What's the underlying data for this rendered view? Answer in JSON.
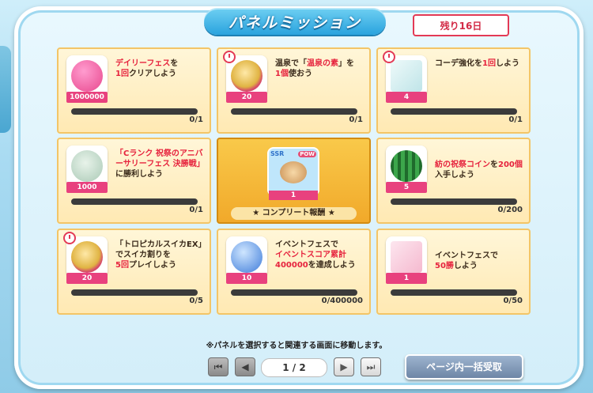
{
  "title": "パネルミッション",
  "days_left": "残り16日",
  "panels": [
    {
      "qty": "1000000",
      "desc_a": "デイリーフェス",
      "desc_b": "を",
      "desc_c": "1回",
      "desc_d": "クリアしよう",
      "progress": "0/1",
      "progress_ratio": 0,
      "timer": false,
      "icon": "coin-icon",
      "color": "#e8478d"
    },
    {
      "qty": "20",
      "desc_a": "温泉で「",
      "desc_b": "温泉の素",
      "desc_c": "」を",
      "desc_d": "1個",
      "desc_e": "使おう",
      "progress": "0/1",
      "progress_ratio": 0,
      "timer": true,
      "icon": "orb-icon",
      "color": "#e0b443"
    },
    {
      "qty": "4",
      "desc_a": "コーデ強化を",
      "desc_b": "1回",
      "desc_c": "しよう",
      "progress": "0/1",
      "progress_ratio": 0,
      "timer": true,
      "icon": "cloth-icon",
      "color": "#bfe4e8"
    },
    {
      "qty": "1000",
      "desc_a": "「Cランク 祝祭のアニバーサリーフェス 決勝戦」",
      "desc_b": "に勝利しよう",
      "progress": "0/1",
      "progress_ratio": 0,
      "timer": false,
      "icon": "medal-icon",
      "color": "#a9c9b5"
    },
    {
      "qty": "5",
      "desc_a": "紡の祝祭コイン",
      "desc_b": "を",
      "desc_c": "200個",
      "desc_d": "入手しよう",
      "progress": "0/200",
      "progress_ratio": 0,
      "timer": false,
      "icon": "watermelon-icon",
      "color": "#3ca64b"
    },
    {
      "qty": "20",
      "desc_a": "「トロピカルスイカEX」",
      "desc_b": "でスイカ割りを",
      "desc_c": "5回",
      "desc_d": "プレイしよう",
      "progress": "0/5",
      "progress_ratio": 0,
      "timer": true,
      "icon": "orb-icon",
      "color": "#e0b443"
    },
    {
      "qty": "10",
      "desc_a": "イベントフェスで",
      "desc_b": "イベントスコア累計400000",
      "desc_c": "を達成しよう",
      "progress": "0/400000",
      "progress_ratio": 0,
      "timer": false,
      "icon": "heart-gem-icon",
      "color": "#3d7bd9"
    },
    {
      "qty": "1",
      "desc_a": "イベントフェスで",
      "desc_b": "50勝",
      "desc_c": "しよう",
      "progress": "0/50",
      "progress_ratio": 0,
      "timer": false,
      "icon": "gift-icon",
      "color": "#f5b9cf"
    }
  ],
  "complete": {
    "ssr": "SSR",
    "pow": "POW",
    "qty": "1",
    "label": "★ コンプリート報酬 ★"
  },
  "note": "※パネルを選択すると関連する画面に移動します。",
  "pager": {
    "indicator": "1 / 2",
    "first": "⏮",
    "prev": "◀",
    "next": "▶",
    "last": "⏭"
  },
  "bulk_button": "ページ内一括受取"
}
